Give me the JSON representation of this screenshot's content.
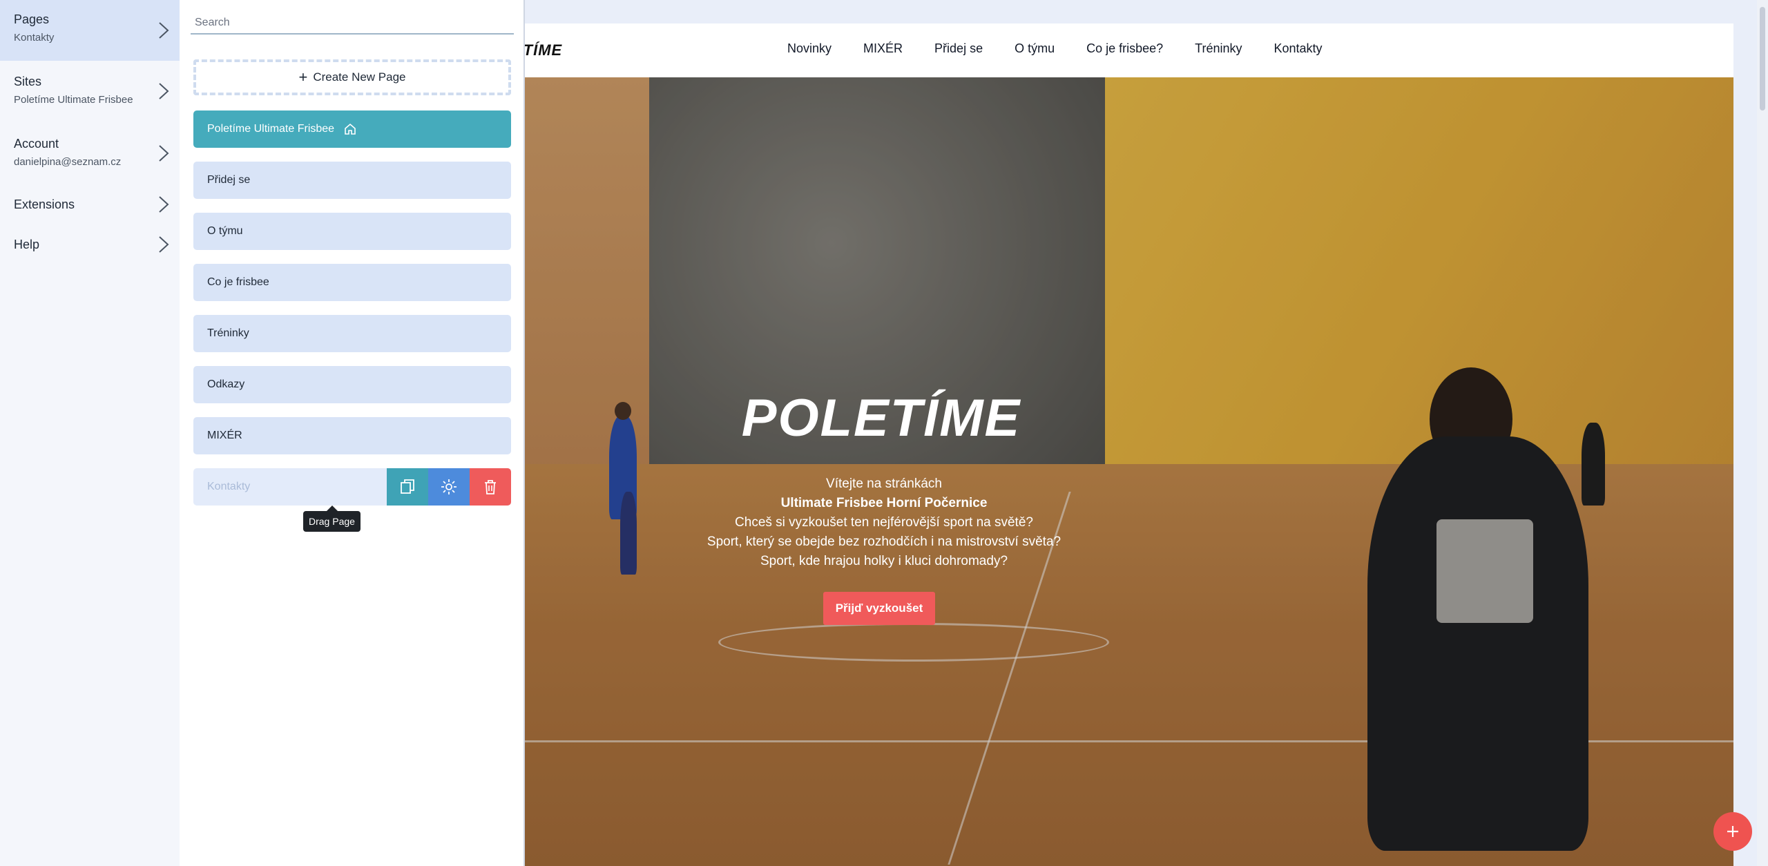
{
  "left_nav": {
    "items": [
      {
        "title": "Pages",
        "subtitle": "Kontakty"
      },
      {
        "title": "Sites",
        "subtitle": "Poletíme Ultimate Frisbee"
      },
      {
        "title": "Account",
        "subtitle": "danielpina@seznam.cz"
      },
      {
        "title": "Extensions",
        "subtitle": ""
      },
      {
        "title": "Help",
        "subtitle": ""
      }
    ]
  },
  "pages_panel": {
    "search_placeholder": "Search",
    "create_label": "Create New Page",
    "pages": [
      {
        "label": "Poletíme Ultimate Frisbee",
        "home": true
      },
      {
        "label": "Přidej se"
      },
      {
        "label": "O týmu"
      },
      {
        "label": "Co je frisbee"
      },
      {
        "label": "Tréninky"
      },
      {
        "label": "Odkazy"
      },
      {
        "label": "MIXÉR"
      },
      {
        "label": "Kontakty"
      }
    ],
    "tooltip": "Drag Page"
  },
  "site": {
    "logo_partial": "ETÍME",
    "nav": [
      "Novinky",
      "MIXÉR",
      "Přidej se",
      "O týmu",
      "Co je frisbee?",
      "Tréninky",
      "Kontakty"
    ],
    "hero": {
      "logo": "POLETÍME",
      "lines": [
        "Vítejte na stránkách",
        "Ultimate Frisbee Horní Počernice",
        "Chceš si vyzkoušet ten nejférovější sport na světě?",
        "Sport, který se obejde bez rozhodčích i na mistrovství světa?",
        "Sport, kde hrajou holky i kluci dohromady?"
      ],
      "cta": "Přijď vyzkoušet"
    }
  },
  "colors": {
    "accent_teal": "#45abbc",
    "gear_blue": "#4d8bdc",
    "danger_red": "#ef5b5b"
  }
}
